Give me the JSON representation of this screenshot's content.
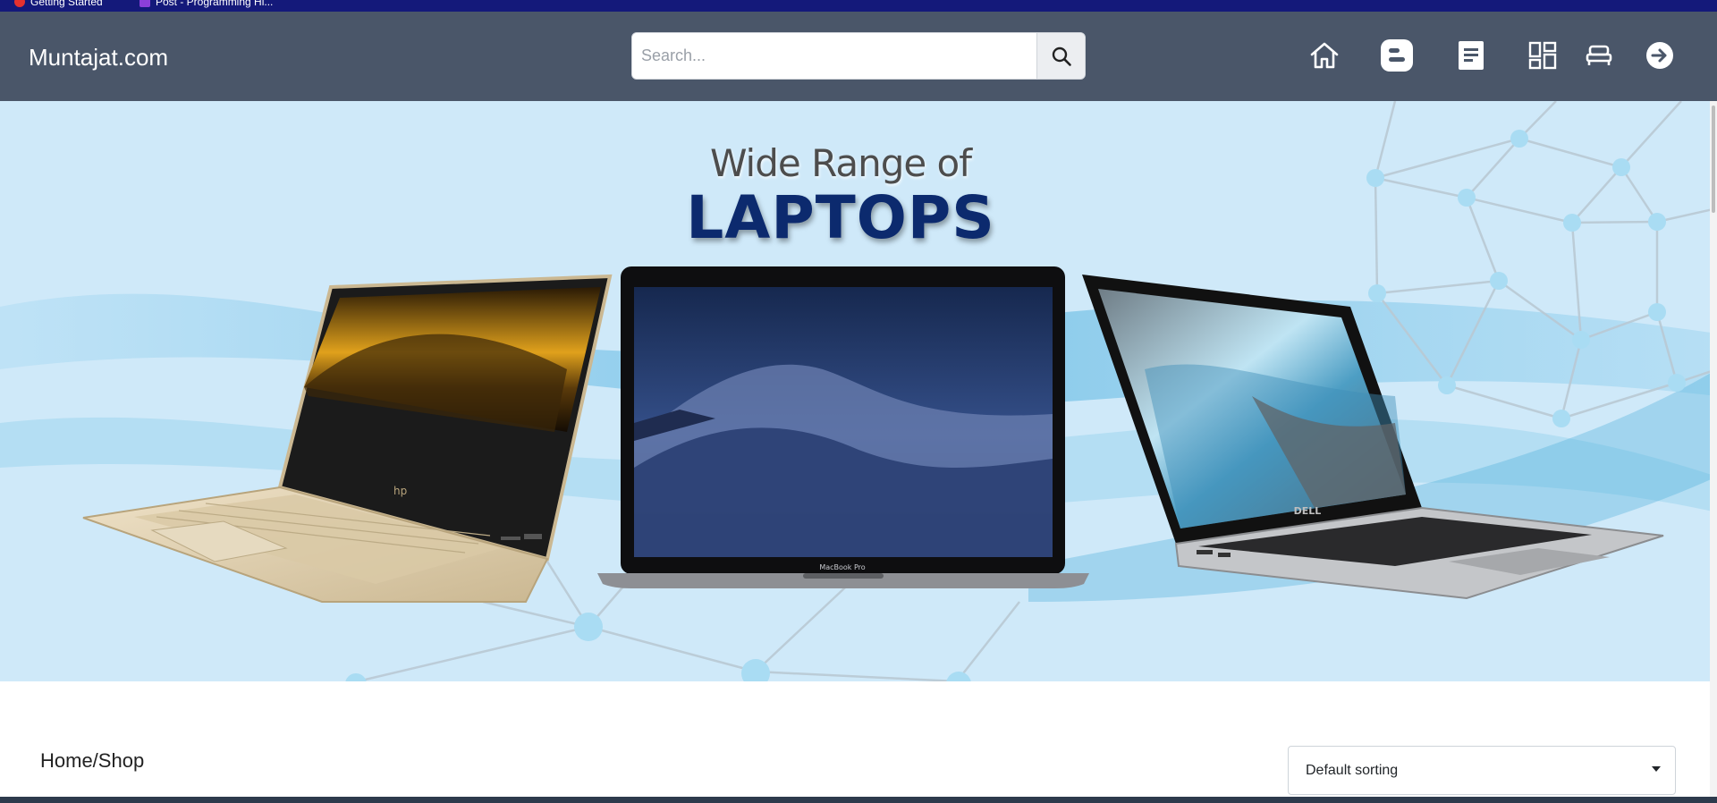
{
  "browser": {
    "bookmarks": [
      "Getting Started",
      "Post - Programming Hi..."
    ]
  },
  "navbar": {
    "brand": "Muntajat.com",
    "search": {
      "placeholder": "Search...",
      "value": ""
    },
    "icons": [
      "home-icon",
      "blogger-icon",
      "document-icon",
      "dashboard-icon",
      "bed-icon",
      "logout-icon"
    ]
  },
  "hero": {
    "line1": "Wide Range of",
    "line2": "LAPTOPS",
    "laptops": [
      {
        "brand": "hp"
      },
      {
        "label": "MacBook Pro"
      },
      {
        "brand": "DELL"
      }
    ]
  },
  "shop": {
    "breadcrumb": "Home/Shop",
    "sort": {
      "selected": "Default sorting"
    }
  },
  "colors": {
    "navbar_bg": "#4a5669",
    "hero_bg": "#cfe9f9",
    "hero_title": "#0c2a6e"
  }
}
